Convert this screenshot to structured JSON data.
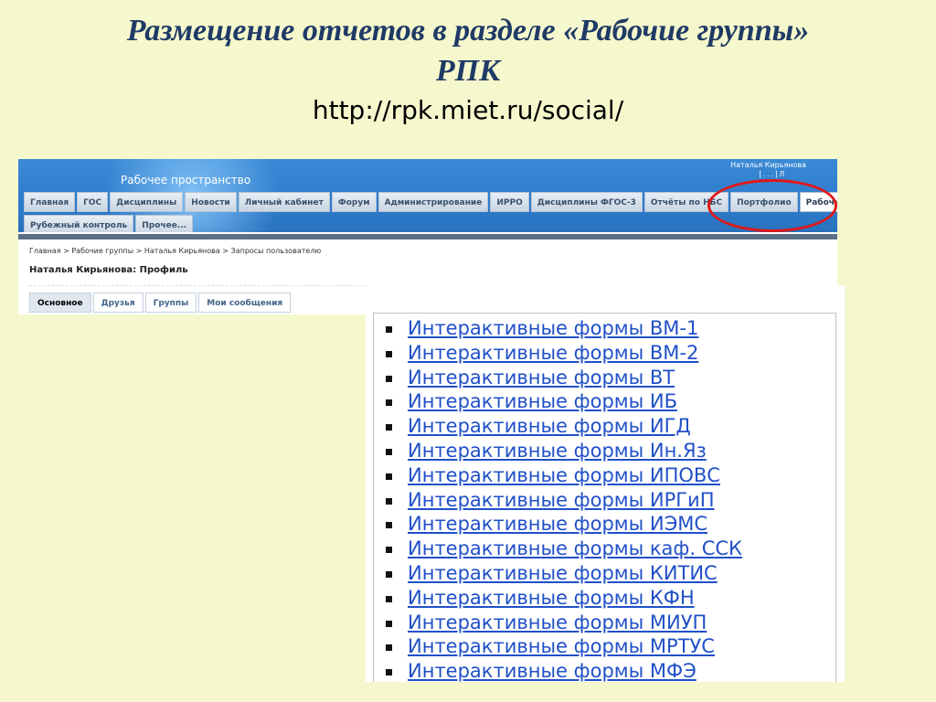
{
  "slide": {
    "title_line1": "Размещение отчетов  в разделе «Рабочие группы»",
    "title_line2": "РПК",
    "url": "http://rpk.miet.ru/social/"
  },
  "site": {
    "workspace_title": "Рабочее пространство",
    "user_name": "Наталья Кирьянова",
    "user_links": "[ . . . ]  Л",
    "nav_row1": [
      "Главная",
      "ГОС",
      "Дисциплины",
      "Новости",
      "Личный кабинет",
      "Форум",
      "Администрирование",
      "ИРРО",
      "Дисциплины ФГОС-3",
      "Отчёты по НБС",
      "Портфолио",
      "Рабочие группы"
    ],
    "nav_row2": [
      "Рубежный контроль",
      "Прочее..."
    ],
    "active_nav": "Рабочие группы",
    "breadcrumb": "Главная > Рабочие группы > Наталья Кирьянова > Запросы пользователю",
    "profile_title": "Наталья Кирьянова: Профиль",
    "profile_tabs": [
      "Основное",
      "Друзья",
      "Группы",
      "Мои сообщения"
    ],
    "active_profile_tab": "Основное"
  },
  "forms_list": [
    "Интерактивные формы ВМ-1",
    "Интерактивные формы ВМ-2",
    "Интерактивные формы ВТ",
    "Интерактивные формы ИБ",
    "Интерактивные формы ИГД",
    "Интерактивные формы Ин.Яз",
    "Интерактивные формы ИПОВС",
    "Интерактивные формы ИРГиП",
    "Интерактивные формы ИЭМС",
    "Интерактивные формы каф. ССК",
    "Интерактивные формы КИТИС",
    "Интерактивные формы КФН",
    "Интерактивные формы МИУП",
    "Интерактивные формы МРТУС",
    "Интерактивные формы МФЭ"
  ],
  "colors": {
    "background": "#f5f8cc",
    "title": "#1f3a66",
    "highlight_circle": "#e01818",
    "link": "#2050c8"
  }
}
